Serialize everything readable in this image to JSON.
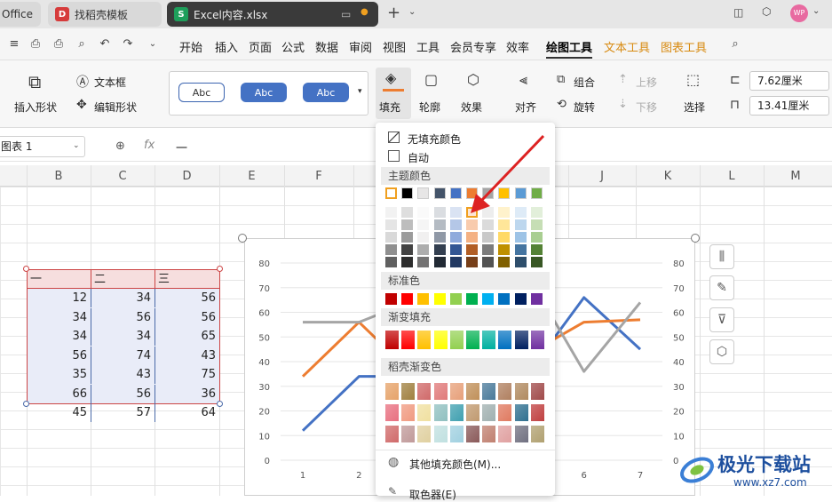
{
  "tabs": [
    {
      "label": "Office",
      "icon": ""
    },
    {
      "label": "找稻壳模板",
      "icon": "D"
    },
    {
      "label": "Excel内容.xlsx",
      "icon": "S"
    }
  ],
  "tab_avatar": "WP",
  "menu": [
    "开始",
    "插入",
    "页面",
    "公式",
    "数据",
    "审阅",
    "视图",
    "工具",
    "会员专享",
    "效率",
    "绘图工具",
    "文本工具",
    "图表工具"
  ],
  "ribbon": {
    "insert_shape": "插入形状",
    "text_box": "文本框",
    "edit_shape": "编辑形状",
    "style1": "Abc",
    "style2": "Abc",
    "style3": "Abc",
    "fill": "填充",
    "outline": "轮廓",
    "effect": "效果",
    "align": "对齐",
    "group": "组合",
    "rotate": "旋转",
    "up": "上移",
    "down": "下移",
    "select": "选择",
    "height": "7.62厘米",
    "width": "13.41厘米"
  },
  "namebox": "图表 1",
  "formula": "一",
  "columns": [
    "B",
    "C",
    "D",
    "E",
    "F",
    "G",
    "H",
    "I",
    "J",
    "K",
    "L",
    "M"
  ],
  "table": {
    "header": [
      "一",
      "二",
      "三"
    ],
    "rows": [
      [
        12,
        34,
        56
      ],
      [
        34,
        56,
        56
      ],
      [
        34,
        34,
        65
      ],
      [
        56,
        74,
        43
      ],
      [
        35,
        43,
        75
      ],
      [
        66,
        56,
        36
      ],
      [
        45,
        57,
        64
      ]
    ]
  },
  "chart_data": {
    "type": "line",
    "x": [
      1,
      2,
      3,
      4,
      5,
      6,
      7
    ],
    "ylim": [
      0,
      80
    ],
    "yticks": [
      0,
      10,
      20,
      30,
      40,
      50,
      60,
      70,
      80
    ],
    "series": [
      {
        "values": [
          12,
          34,
          34,
          56,
          35,
          66,
          45
        ],
        "color": "#4472c4"
      },
      {
        "values": [
          34,
          56,
          34,
          74,
          43,
          56,
          57
        ],
        "color": "#ed7d31"
      },
      {
        "values": [
          56,
          56,
          65,
          43,
          75,
          36,
          64
        ],
        "color": "#a5a5a5"
      }
    ]
  },
  "dropdown": {
    "no_fill": "无填充颜色",
    "auto": "自动",
    "theme_colors": "主题颜色",
    "standard_colors": "标准色",
    "gradient_fill": "渐变填充",
    "docer_gradient": "稻壳渐变色",
    "more_colors": "其他填充颜色(M)...",
    "picker": "取色器(E)",
    "theme_row": [
      "#ffffff",
      "#000000",
      "#e7e6e6",
      "#44546a",
      "#4472c4",
      "#ed7d31",
      "#a5a5a5",
      "#ffc000",
      "#5b9bd5",
      "#70ad47"
    ],
    "standard_row": [
      "#c00000",
      "#ff0000",
      "#ffc000",
      "#ffff00",
      "#92d050",
      "#00b050",
      "#00b0f0",
      "#0070c0",
      "#002060",
      "#7030a0"
    ],
    "gradient_row": [
      "#c00000",
      "#ff0000",
      "#ffc000",
      "#ffff00",
      "#92d050",
      "#00b050",
      "#00b0a0",
      "#0070c0",
      "#002060",
      "#7030a0"
    ]
  },
  "watermark": {
    "main": "极光下载站",
    "sub": "www.xz7.com"
  }
}
